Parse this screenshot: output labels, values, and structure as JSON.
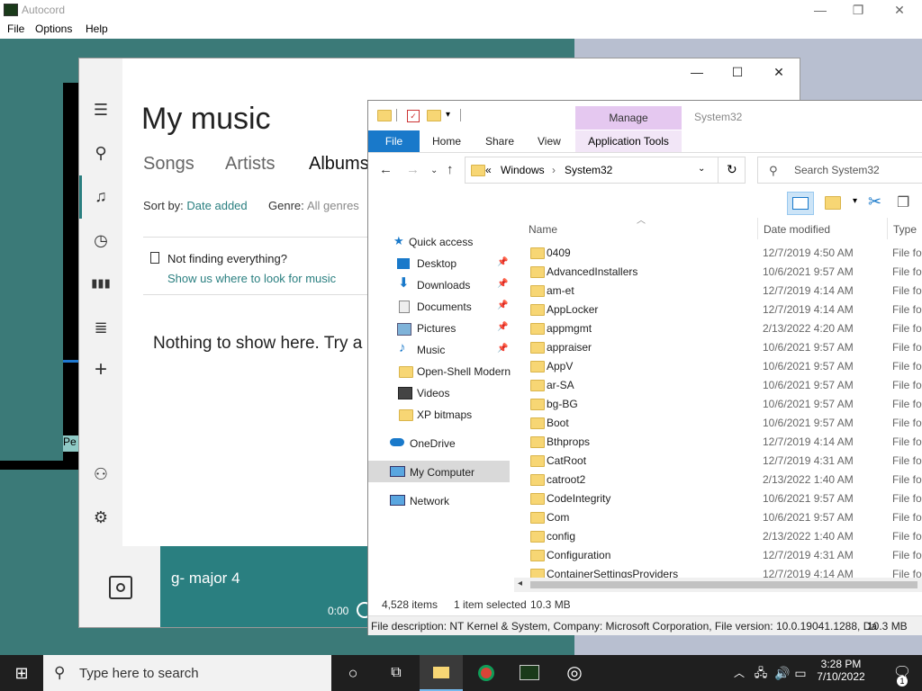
{
  "autocord": {
    "title": "Autocord",
    "menu": [
      "File",
      "Options",
      "Help"
    ],
    "caption": {
      "minimize": "—",
      "maximize": "❐",
      "close": "✕"
    },
    "partial_label": "Pe"
  },
  "groove": {
    "title": "My music",
    "tabs": [
      "Songs",
      "Artists",
      "Albums"
    ],
    "sort_label": "Sort by:",
    "sort_value": "Date added",
    "genre_label": "Genre:",
    "genre_value": "All genres",
    "not_finding": "Not finding everything?",
    "show_where": "Show us where to look for music",
    "nothing": "Nothing to show here. Try a",
    "now_playing": "g- major 4",
    "time": "0:00",
    "caption": {
      "minimize": "—",
      "maximize": "☐",
      "close": "✕"
    }
  },
  "explorer": {
    "manage": "Manage",
    "window_title": "System32",
    "ribbon_tabs": [
      "File",
      "Home",
      "Share",
      "View",
      "Application Tools"
    ],
    "address": {
      "prefix": "«",
      "parts": [
        "Windows",
        "System32"
      ]
    },
    "search_placeholder": "Search System32",
    "tree": {
      "quick_access": "Quick access",
      "items": [
        {
          "label": "Desktop",
          "pinned": true
        },
        {
          "label": "Downloads",
          "pinned": true
        },
        {
          "label": "Documents",
          "pinned": true
        },
        {
          "label": "Pictures",
          "pinned": true
        },
        {
          "label": "Music",
          "pinned": true
        },
        {
          "label": "Open-Shell Modern",
          "pinned": false
        },
        {
          "label": "Videos",
          "pinned": false
        },
        {
          "label": "XP bitmaps",
          "pinned": false
        }
      ],
      "onedrive": "OneDrive",
      "computer": "My Computer",
      "network": "Network"
    },
    "columns": {
      "name": "Name",
      "date": "Date modified",
      "type": "Type"
    },
    "files": [
      {
        "name": "0409",
        "date": "12/7/2019 4:50 AM",
        "type": "File fo"
      },
      {
        "name": "AdvancedInstallers",
        "date": "10/6/2021 9:57 AM",
        "type": "File fo"
      },
      {
        "name": "am-et",
        "date": "12/7/2019 4:14 AM",
        "type": "File fo"
      },
      {
        "name": "AppLocker",
        "date": "12/7/2019 4:14 AM",
        "type": "File fo"
      },
      {
        "name": "appmgmt",
        "date": "2/13/2022 4:20 AM",
        "type": "File fo"
      },
      {
        "name": "appraiser",
        "date": "10/6/2021 9:57 AM",
        "type": "File fo"
      },
      {
        "name": "AppV",
        "date": "10/6/2021 9:57 AM",
        "type": "File fo"
      },
      {
        "name": "ar-SA",
        "date": "10/6/2021 9:57 AM",
        "type": "File fo"
      },
      {
        "name": "bg-BG",
        "date": "10/6/2021 9:57 AM",
        "type": "File fo"
      },
      {
        "name": "Boot",
        "date": "10/6/2021 9:57 AM",
        "type": "File fo"
      },
      {
        "name": "Bthprops",
        "date": "12/7/2019 4:14 AM",
        "type": "File fo"
      },
      {
        "name": "CatRoot",
        "date": "12/7/2019 4:31 AM",
        "type": "File fo"
      },
      {
        "name": "catroot2",
        "date": "2/13/2022 1:40 AM",
        "type": "File fo"
      },
      {
        "name": "CodeIntegrity",
        "date": "10/6/2021 9:57 AM",
        "type": "File fo"
      },
      {
        "name": "Com",
        "date": "10/6/2021 9:57 AM",
        "type": "File fo"
      },
      {
        "name": "config",
        "date": "2/13/2022 1:40 AM",
        "type": "File fo"
      },
      {
        "name": "Configuration",
        "date": "12/7/2019 4:31 AM",
        "type": "File fo"
      },
      {
        "name": "ContainerSettingsProviders",
        "date": "12/7/2019 4:14 AM",
        "type": "File fo"
      }
    ],
    "status": {
      "count": "4,528 items",
      "selected": "1 item selected",
      "size": "10.3 MB"
    },
    "description": "File description: NT Kernel & System, Company: Microsoft Corporation, File version: 10.0.19041.1288, Da",
    "description_size": "10.3 MB"
  },
  "taskbar": {
    "search_placeholder": "Type here to search",
    "time": "3:28 PM",
    "date": "7/10/2022",
    "notification_count": "1"
  }
}
